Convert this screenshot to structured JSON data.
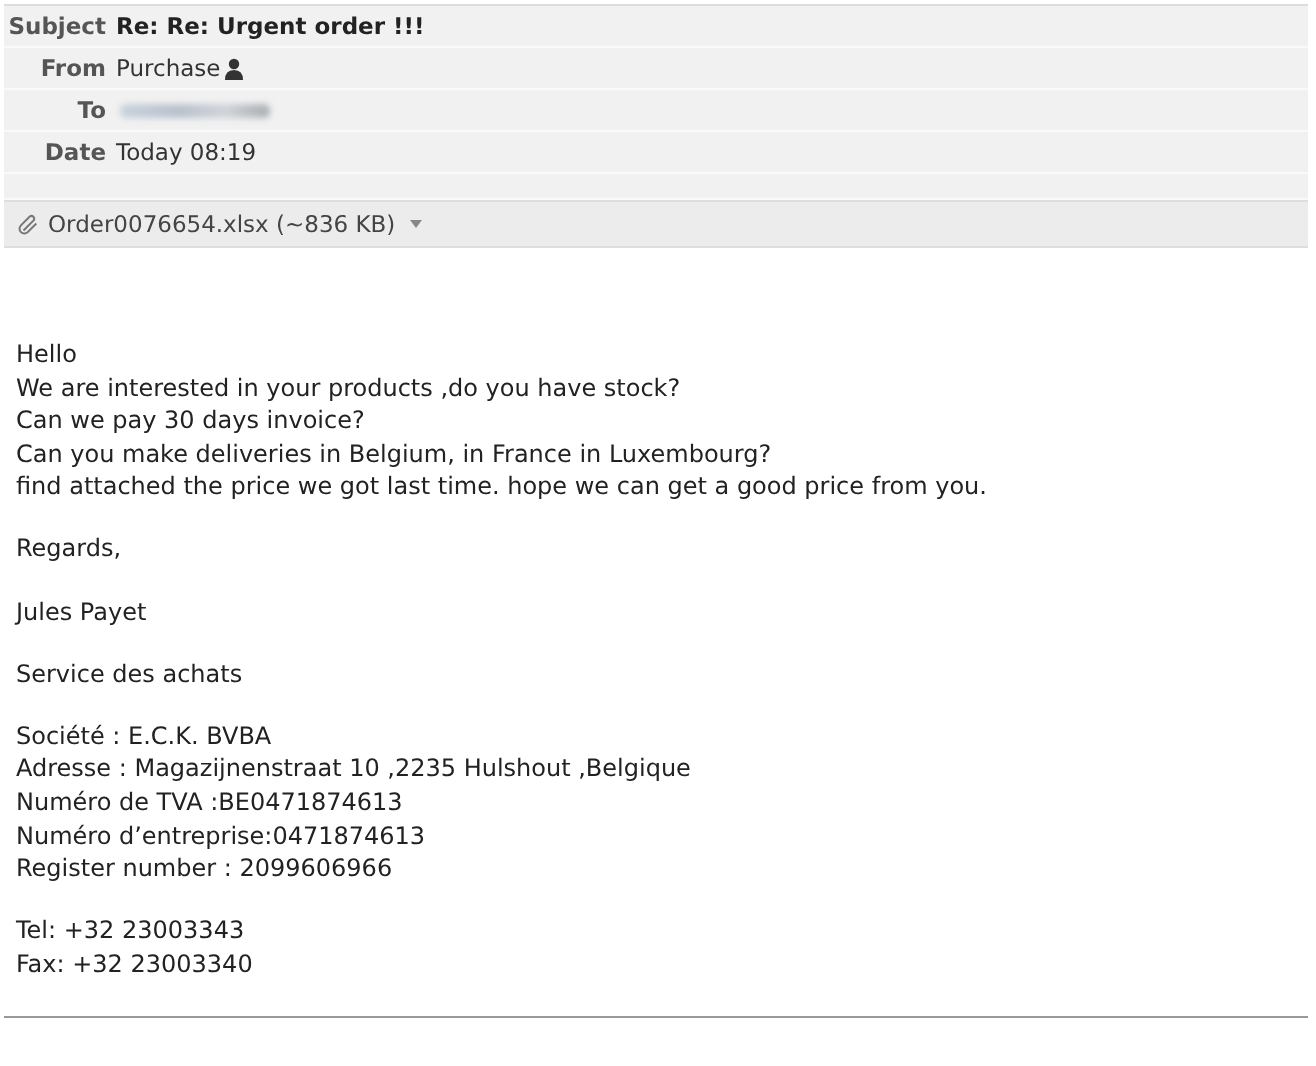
{
  "header": {
    "fields": [
      {
        "label": "Subject",
        "kind": "subject",
        "value": "Re: Re: Urgent order !!!"
      },
      {
        "label": "From",
        "kind": "contact",
        "value": "Purchase"
      },
      {
        "label": "To",
        "kind": "redacted"
      },
      {
        "label": "Date",
        "kind": "plain",
        "value": "Today 08:19"
      }
    ]
  },
  "attachment": {
    "name": "Order0076654.xlsx (~836 KB)"
  },
  "body": {
    "paragraphs": [
      [
        "Hello",
        "We are interested in your products ,do you have stock?",
        "Can we pay 30 days invoice?",
        "Can you make deliveries in Belgium, in France in Luxembourg?",
        "find attached the price we got last time. hope we can get a good price from you."
      ],
      [
        "Regards,"
      ],
      [
        "Jules Payet"
      ],
      [
        "Service des achats"
      ],
      [
        "Société : E.C.K. BVBA",
        "Adresse : Magazijnenstraat 10 ,2235 Hulshout ,Belgique",
        "Numéro de TVA :BE0471874613",
        "Numéro d’entreprise:0471874613",
        "Register number : 2099606966"
      ],
      [
        "Tel: +32 23003343",
        "Fax: +32 23003340"
      ]
    ]
  }
}
